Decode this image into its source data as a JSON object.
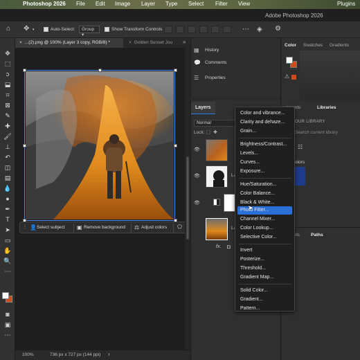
{
  "menubar": {
    "app_name": "Photoshop 2026",
    "items": [
      "File",
      "Edit",
      "Image",
      "Layer",
      "Type",
      "Select",
      "Filter",
      "View",
      "Plugins"
    ]
  },
  "window_title": "Adobe Photoshop 2026",
  "options_bar": {
    "auto_select_label": "Auto-Select:",
    "auto_select_target": "Group",
    "transform_controls_label": "Show Transform Controls"
  },
  "tabs": [
    {
      "label": "...(2).png @ 100% (Layer 3 copy, RGB/8) *",
      "active": true
    },
    {
      "label": "Golden Sunset Jou",
      "active": false
    }
  ],
  "taskbar": {
    "select_subject": "Select subject",
    "remove_background": "Remove background",
    "adjust_colors": "Adjust colors",
    "more_icon": "⋯"
  },
  "status": {
    "zoom": "100%",
    "dimensions": "736 px x 727 px (144 ppi)"
  },
  "right_strip": {
    "items": [
      "History",
      "Comments",
      "Properties"
    ]
  },
  "layers_panel": {
    "tab": "Layers",
    "blend_mode": "Normal",
    "lock_label": "Lock:",
    "layer_name_partial": "La",
    "fx_label": "fx."
  },
  "color_panel": {
    "tabs": [
      "Color",
      "Swatches",
      "Gradients"
    ],
    "foreground": "#ffffff",
    "background": "#d24a1a"
  },
  "libraries_panel": {
    "tabs_partial": "ustments",
    "active_tab": "Libraries",
    "section_title": "OUR LIBRARY",
    "search_placeholder": "Search current library",
    "colors_label": "olors",
    "swatch_color": "#1e3a8a"
  },
  "paths_panel": {
    "tab_partial": "nels",
    "active_tab": "Paths"
  },
  "adjustment_menu": {
    "groups": [
      [
        "Color and vibrance...",
        "Clarity and dehaze...",
        "Grain..."
      ],
      [
        "Brightness/Contrast...",
        "Levels...",
        "Curves...",
        "Exposure..."
      ],
      [
        "Hue/Saturation...",
        "Color Balance...",
        "Black & White...",
        "Photo Filter...",
        "Channel Mixer...",
        "Color Lookup...",
        "Selective Color..."
      ],
      [
        "Invert",
        "Posterize...",
        "Threshold...",
        "Gradient Map..."
      ],
      [
        "Solid Color...",
        "Gradient...",
        "Pattern..."
      ]
    ],
    "highlighted": "Photo Filter..."
  }
}
